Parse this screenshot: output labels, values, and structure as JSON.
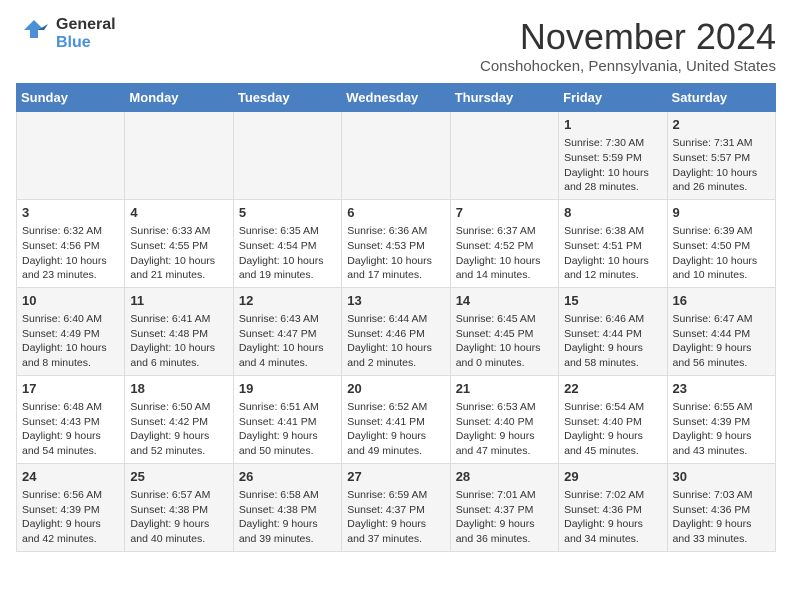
{
  "logo": {
    "line1": "General",
    "line2": "Blue"
  },
  "title": "November 2024",
  "subtitle": "Conshohocken, Pennsylvania, United States",
  "days_of_week": [
    "Sunday",
    "Monday",
    "Tuesday",
    "Wednesday",
    "Thursday",
    "Friday",
    "Saturday"
  ],
  "weeks": [
    [
      {
        "day": "",
        "info": ""
      },
      {
        "day": "",
        "info": ""
      },
      {
        "day": "",
        "info": ""
      },
      {
        "day": "",
        "info": ""
      },
      {
        "day": "",
        "info": ""
      },
      {
        "day": "1",
        "info": "Sunrise: 7:30 AM\nSunset: 5:59 PM\nDaylight: 10 hours and 28 minutes."
      },
      {
        "day": "2",
        "info": "Sunrise: 7:31 AM\nSunset: 5:57 PM\nDaylight: 10 hours and 26 minutes."
      }
    ],
    [
      {
        "day": "3",
        "info": "Sunrise: 6:32 AM\nSunset: 4:56 PM\nDaylight: 10 hours and 23 minutes."
      },
      {
        "day": "4",
        "info": "Sunrise: 6:33 AM\nSunset: 4:55 PM\nDaylight: 10 hours and 21 minutes."
      },
      {
        "day": "5",
        "info": "Sunrise: 6:35 AM\nSunset: 4:54 PM\nDaylight: 10 hours and 19 minutes."
      },
      {
        "day": "6",
        "info": "Sunrise: 6:36 AM\nSunset: 4:53 PM\nDaylight: 10 hours and 17 minutes."
      },
      {
        "day": "7",
        "info": "Sunrise: 6:37 AM\nSunset: 4:52 PM\nDaylight: 10 hours and 14 minutes."
      },
      {
        "day": "8",
        "info": "Sunrise: 6:38 AM\nSunset: 4:51 PM\nDaylight: 10 hours and 12 minutes."
      },
      {
        "day": "9",
        "info": "Sunrise: 6:39 AM\nSunset: 4:50 PM\nDaylight: 10 hours and 10 minutes."
      }
    ],
    [
      {
        "day": "10",
        "info": "Sunrise: 6:40 AM\nSunset: 4:49 PM\nDaylight: 10 hours and 8 minutes."
      },
      {
        "day": "11",
        "info": "Sunrise: 6:41 AM\nSunset: 4:48 PM\nDaylight: 10 hours and 6 minutes."
      },
      {
        "day": "12",
        "info": "Sunrise: 6:43 AM\nSunset: 4:47 PM\nDaylight: 10 hours and 4 minutes."
      },
      {
        "day": "13",
        "info": "Sunrise: 6:44 AM\nSunset: 4:46 PM\nDaylight: 10 hours and 2 minutes."
      },
      {
        "day": "14",
        "info": "Sunrise: 6:45 AM\nSunset: 4:45 PM\nDaylight: 10 hours and 0 minutes."
      },
      {
        "day": "15",
        "info": "Sunrise: 6:46 AM\nSunset: 4:44 PM\nDaylight: 9 hours and 58 minutes."
      },
      {
        "day": "16",
        "info": "Sunrise: 6:47 AM\nSunset: 4:44 PM\nDaylight: 9 hours and 56 minutes."
      }
    ],
    [
      {
        "day": "17",
        "info": "Sunrise: 6:48 AM\nSunset: 4:43 PM\nDaylight: 9 hours and 54 minutes."
      },
      {
        "day": "18",
        "info": "Sunrise: 6:50 AM\nSunset: 4:42 PM\nDaylight: 9 hours and 52 minutes."
      },
      {
        "day": "19",
        "info": "Sunrise: 6:51 AM\nSunset: 4:41 PM\nDaylight: 9 hours and 50 minutes."
      },
      {
        "day": "20",
        "info": "Sunrise: 6:52 AM\nSunset: 4:41 PM\nDaylight: 9 hours and 49 minutes."
      },
      {
        "day": "21",
        "info": "Sunrise: 6:53 AM\nSunset: 4:40 PM\nDaylight: 9 hours and 47 minutes."
      },
      {
        "day": "22",
        "info": "Sunrise: 6:54 AM\nSunset: 4:40 PM\nDaylight: 9 hours and 45 minutes."
      },
      {
        "day": "23",
        "info": "Sunrise: 6:55 AM\nSunset: 4:39 PM\nDaylight: 9 hours and 43 minutes."
      }
    ],
    [
      {
        "day": "24",
        "info": "Sunrise: 6:56 AM\nSunset: 4:39 PM\nDaylight: 9 hours and 42 minutes."
      },
      {
        "day": "25",
        "info": "Sunrise: 6:57 AM\nSunset: 4:38 PM\nDaylight: 9 hours and 40 minutes."
      },
      {
        "day": "26",
        "info": "Sunrise: 6:58 AM\nSunset: 4:38 PM\nDaylight: 9 hours and 39 minutes."
      },
      {
        "day": "27",
        "info": "Sunrise: 6:59 AM\nSunset: 4:37 PM\nDaylight: 9 hours and 37 minutes."
      },
      {
        "day": "28",
        "info": "Sunrise: 7:01 AM\nSunset: 4:37 PM\nDaylight: 9 hours and 36 minutes."
      },
      {
        "day": "29",
        "info": "Sunrise: 7:02 AM\nSunset: 4:36 PM\nDaylight: 9 hours and 34 minutes."
      },
      {
        "day": "30",
        "info": "Sunrise: 7:03 AM\nSunset: 4:36 PM\nDaylight: 9 hours and 33 minutes."
      }
    ]
  ]
}
